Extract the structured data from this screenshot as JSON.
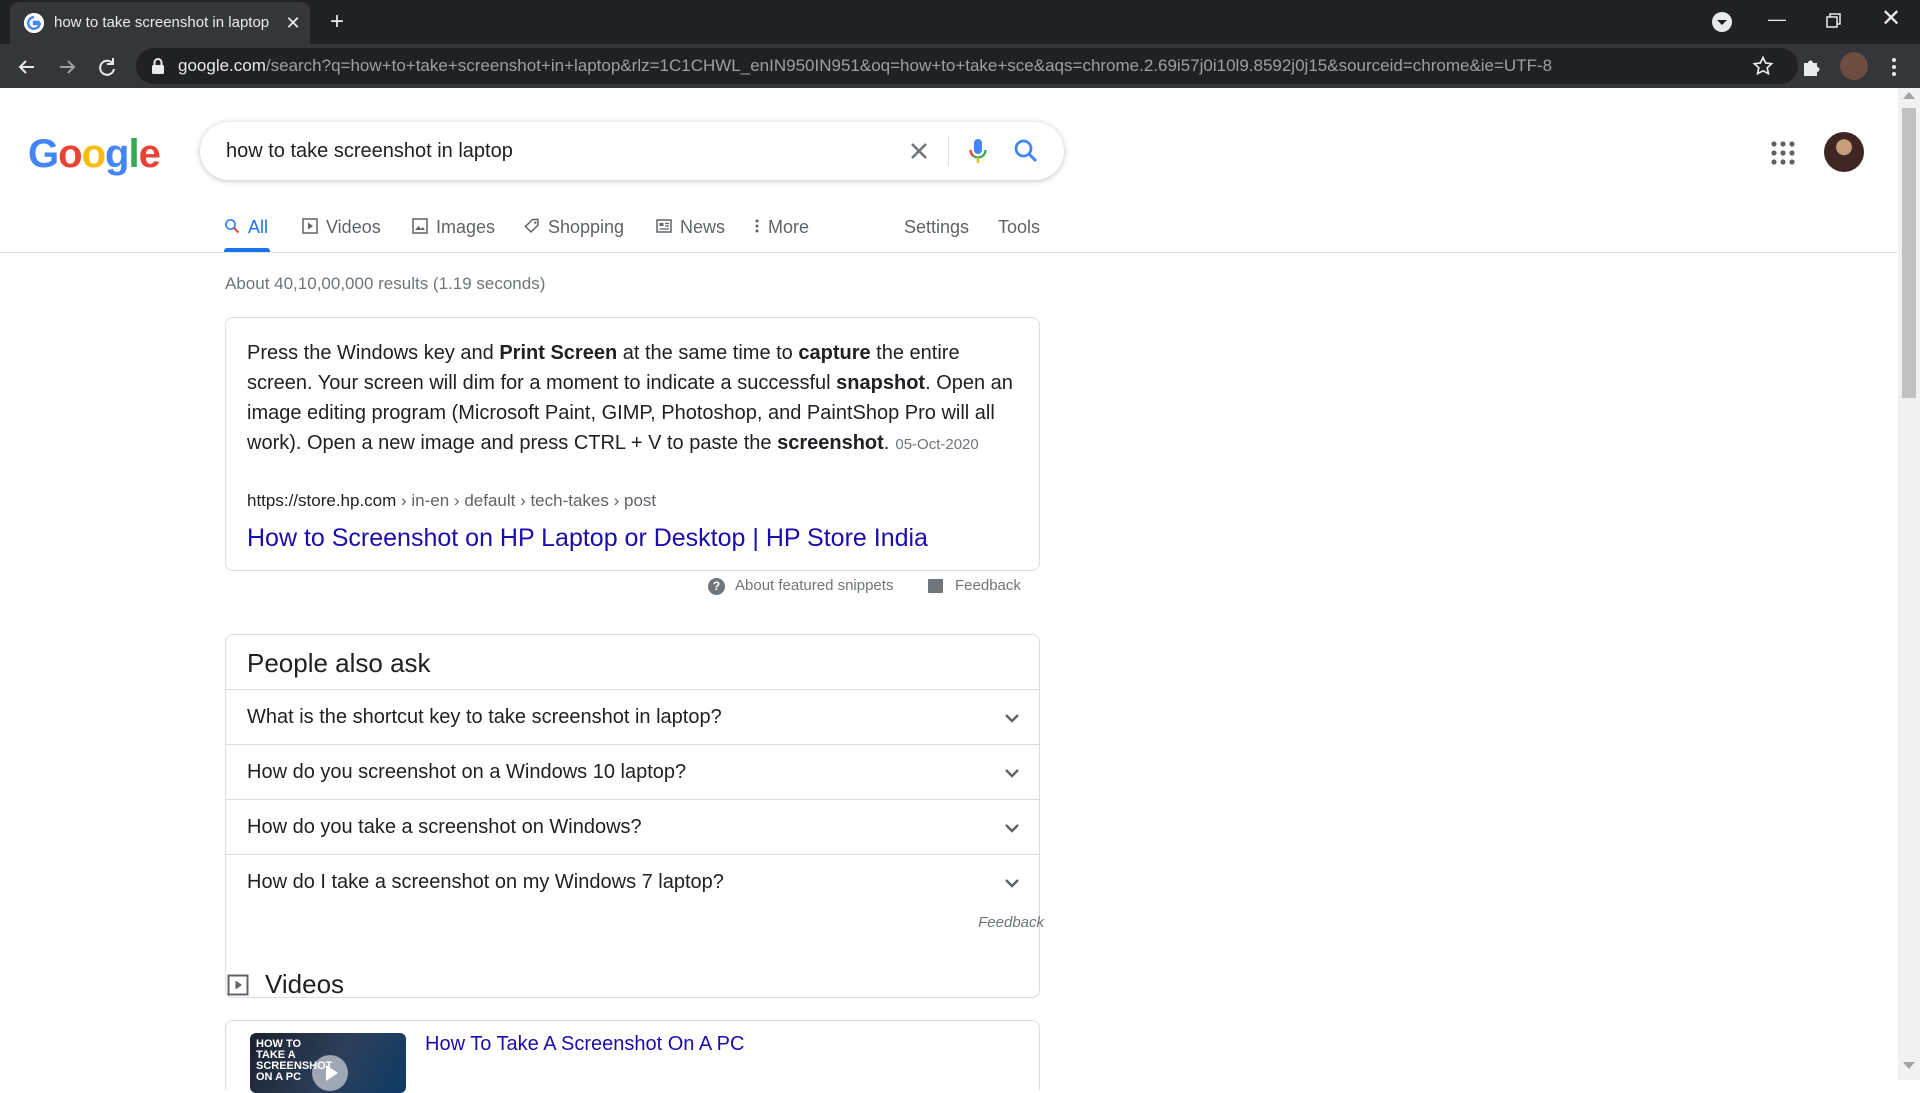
{
  "browser": {
    "tab_title": "how to take screenshot in laptop",
    "tab_close_glyph": "✕",
    "new_tab_glyph": "+",
    "url_domain": "google.com",
    "url_path": "/search?q=how+to+take+screenshot+in+laptop&rlz=1C1CHWL_enIN950IN951&oq=how+to+take+sce&aqs=chrome.2.69i57j0i10l9.8592j0j15&sourceid=chrome&ie=UTF-8",
    "minimize_glyph": "—",
    "close_glyph": "✕"
  },
  "logo": {
    "letters": [
      "G",
      "o",
      "o",
      "g",
      "l",
      "e"
    ],
    "colors": [
      "#4285f4",
      "#ea4335",
      "#fbbc05",
      "#4285f4",
      "#34a853",
      "#ea4335"
    ]
  },
  "search": {
    "query": "how to take screenshot in laptop"
  },
  "tabs": {
    "all": "All",
    "videos": "Videos",
    "images": "Images",
    "shopping": "Shopping",
    "news": "News",
    "more": "More",
    "settings": "Settings",
    "tools": "Tools"
  },
  "result_stats": "About 40,10,00,000 results (1.19 seconds)",
  "snippet": {
    "parts": [
      {
        "t": "Press the Windows key and ",
        "b": false
      },
      {
        "t": "Print Screen",
        "b": true
      },
      {
        "t": " at the same time to ",
        "b": false
      },
      {
        "t": "capture",
        "b": true
      },
      {
        "t": " the entire screen. Your screen will dim for a moment to indicate a successful ",
        "b": false
      },
      {
        "t": "snapshot",
        "b": true
      },
      {
        "t": ". Open an image editing program (Microsoft Paint, GIMP, Photoshop, and PaintShop Pro will all work). Open a new image and press CTRL + V to paste the ",
        "b": false
      },
      {
        "t": "screenshot",
        "b": true
      },
      {
        "t": ".",
        "b": false
      }
    ],
    "date": "05-Oct-2020",
    "cite_domain": "https://store.hp.com",
    "cite_crumbs": " › in-en › default › tech-takes › post",
    "link_title": "How to Screenshot on HP Laptop or Desktop | HP Store India",
    "about_label": "About featured snippets",
    "feedback_label": "Feedback"
  },
  "paa": {
    "title": "People also ask",
    "questions": [
      "What is the shortcut key to take screenshot in laptop?",
      "How do you screenshot on a Windows 10 laptop?",
      "How do you take a screenshot on Windows?",
      "How do I take a screenshot on my Windows 7 laptop?"
    ],
    "feedback_label": "Feedback"
  },
  "videos": {
    "title": "Videos",
    "items": [
      {
        "title": "How To Take A Screenshot On A PC",
        "thumb_text": "HOW TO TAKE A SCREENSHOT ON A PC"
      }
    ]
  },
  "colors": {
    "accent": "#1a73e8",
    "link": "#1a0dab",
    "chrome_dark": "#202124",
    "chrome_toolbar": "#35363a"
  }
}
